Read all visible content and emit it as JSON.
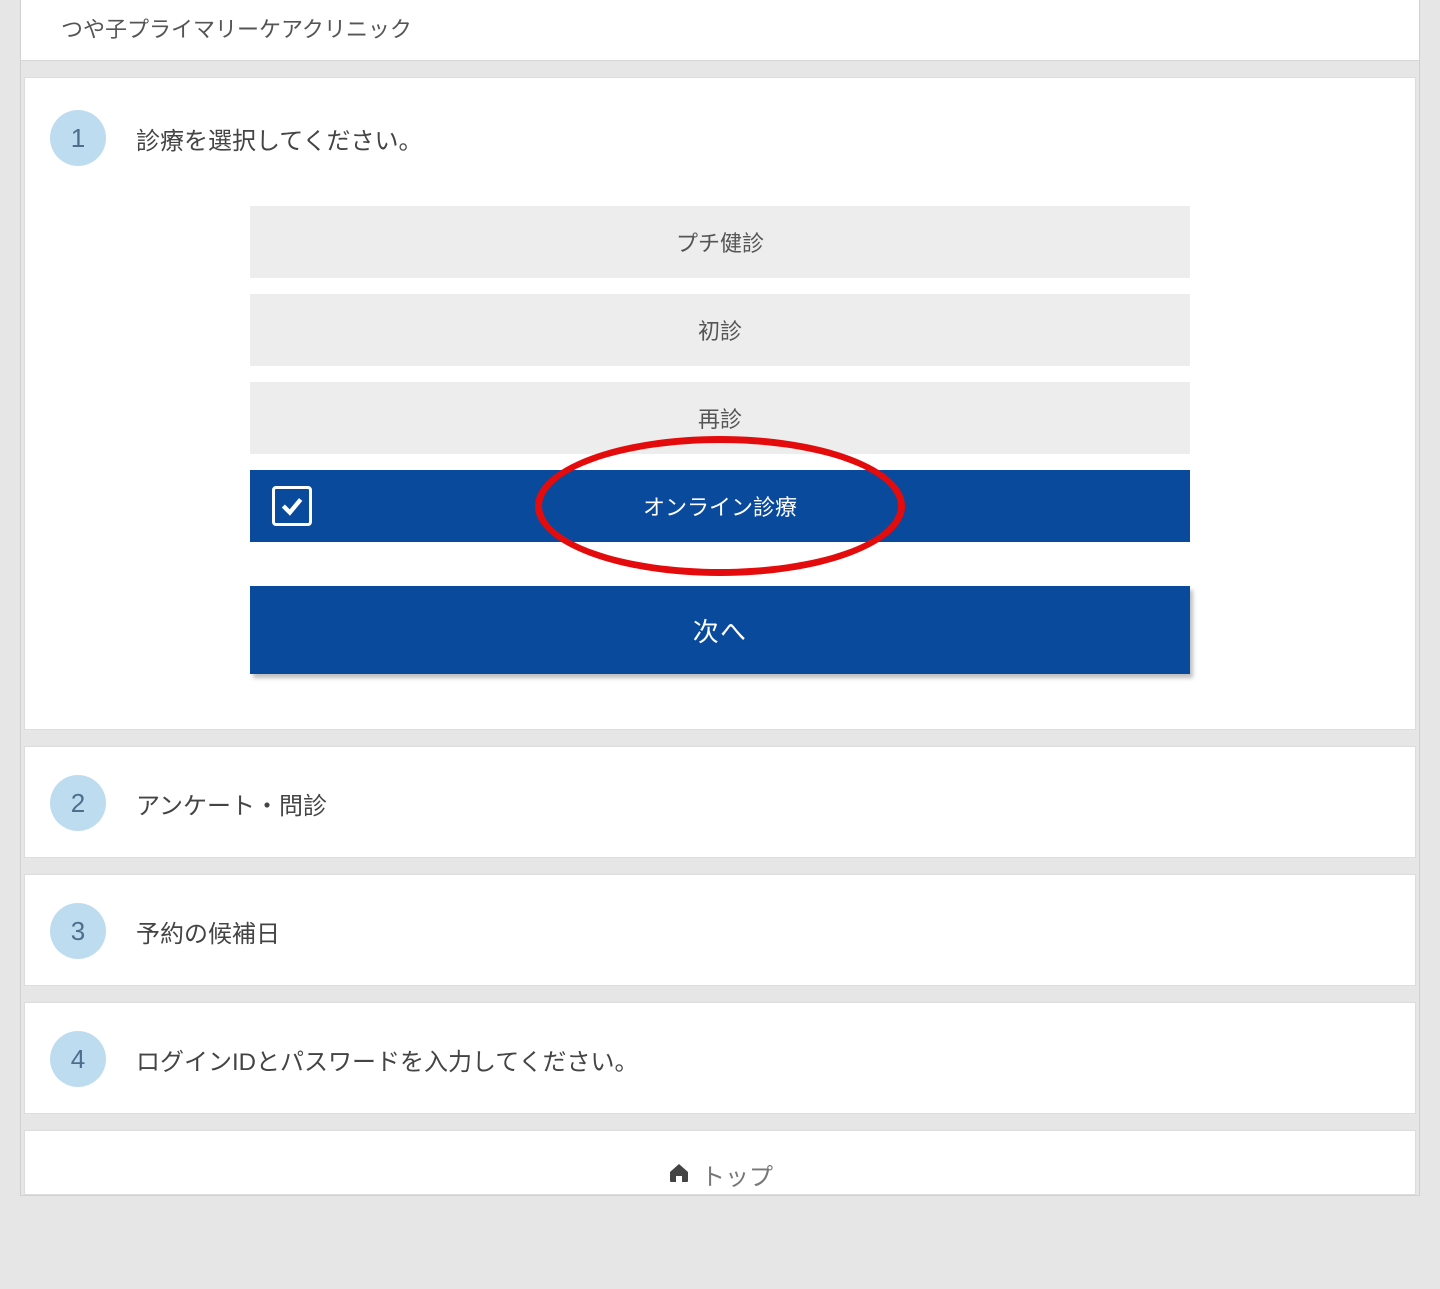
{
  "header": {
    "clinic_name": "つや子プライマリーケアクリニック"
  },
  "steps": {
    "s1": {
      "num": "1",
      "title": "診療を選択してください。"
    },
    "s2": {
      "num": "2",
      "title": "アンケート・問診"
    },
    "s3": {
      "num": "3",
      "title": "予約の候補日"
    },
    "s4": {
      "num": "4",
      "title": "ログインIDとパスワードを入力してください。"
    }
  },
  "options": {
    "o1": "プチ健診",
    "o2": "初診",
    "o3": "再診",
    "o4": "オンライン診療"
  },
  "buttons": {
    "next": "次へ"
  },
  "footer": {
    "top": "トップ"
  },
  "colors": {
    "brand": "#0a4a9c",
    "annotation": "#e30b0b",
    "step_badge": "#bedcf0"
  }
}
